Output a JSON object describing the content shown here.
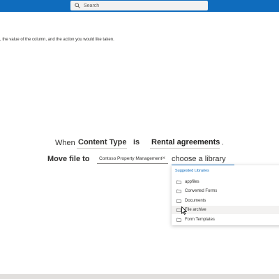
{
  "search": {
    "placeholder": "Search"
  },
  "instruction": ", the value of the column, and the action you would like taken.",
  "rule": {
    "when_label": "When",
    "column": "Content Type",
    "operator": "is",
    "value": "Rental agreements",
    "comma": ","
  },
  "action": {
    "label": "Move file to",
    "site_pill": "Contoso Property Management",
    "remove_glyph": "×",
    "library_placeholder": "choose a library"
  },
  "dropdown": {
    "header": "Suggested Libraries",
    "items": [
      {
        "label": "appfiles"
      },
      {
        "label": "Converted Forms"
      },
      {
        "label": "Documents"
      },
      {
        "label": "File archive"
      },
      {
        "label": "Form Templates"
      }
    ],
    "hovered_item": "File archive"
  },
  "colors": {
    "brand": "#0f6cbd",
    "link": "#0f6cbd",
    "text": "#323130"
  },
  "icons": {
    "search": "search-icon",
    "folder": "folder-icon",
    "close": "close-icon"
  }
}
